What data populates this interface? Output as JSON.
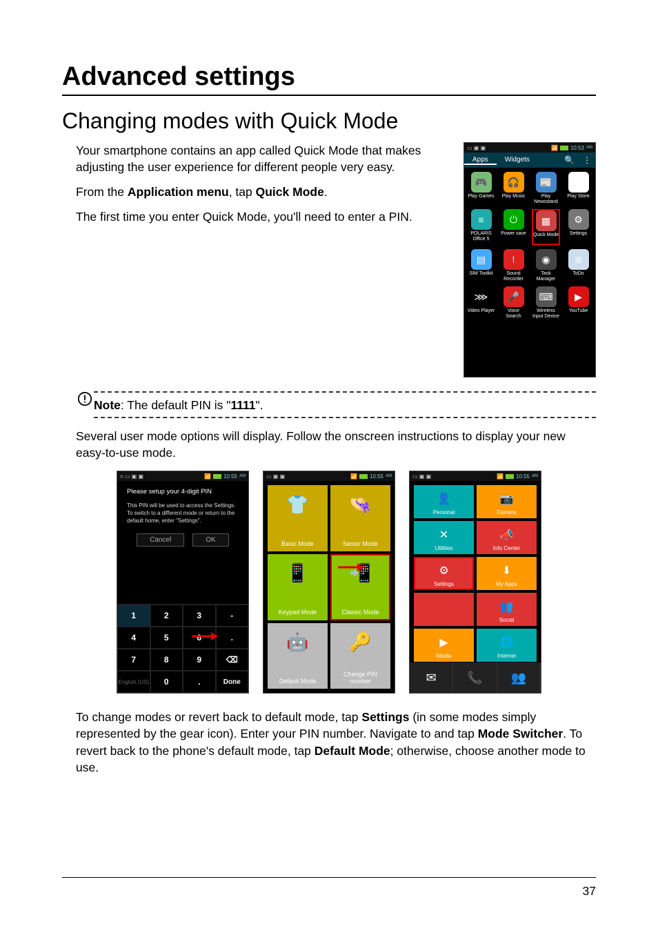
{
  "page_number": "37",
  "headings": {
    "h1": "Advanced settings",
    "h2": "Changing modes with Quick Mode"
  },
  "paragraphs": {
    "p1": "Your smartphone contains an app called Quick Mode that makes adjusting the user experience for different people very easy.",
    "p2_pre": "From the ",
    "p2_b1": "Application menu",
    "p2_mid": ", tap ",
    "p2_b2": "Quick Mode",
    "p2_post": ".",
    "p3": "The first time you enter Quick Mode, you'll need to enter a PIN.",
    "p4": "Several user mode options will display. Follow the onscreen instructions to display your new easy-to-use mode.",
    "p5_a": "To change modes or revert back to default mode, tap ",
    "p5_b1": "Settings",
    "p5_b": " (in some modes simply represented by the gear icon). Enter your PIN number. Navigate to and tap ",
    "p5_b2": "Mode Switcher",
    "p5_c": ". To revert back to the phone's default mode, tap ",
    "p5_b3": "Default Mode",
    "p5_d": "; otherwise, choose another mode to use."
  },
  "note": {
    "label": "Note",
    "text_a": ": The default PIN is \"",
    "pin": "1111",
    "text_b": "\"."
  },
  "phone_main": {
    "status_time": "10:53",
    "status_ampm": "AM",
    "tabs": {
      "apps": "Apps",
      "widgets": "Widgets"
    },
    "apps": [
      {
        "label": "Play Games",
        "bg": "#7b7",
        "glyph": "🎮"
      },
      {
        "label": "Play Music",
        "bg": "#f90",
        "glyph": "🎧"
      },
      {
        "label": "Play\nNewsstand",
        "bg": "#48c",
        "glyph": "📰"
      },
      {
        "label": "Play Store",
        "bg": "#fff",
        "glyph": "▶"
      },
      {
        "label": "POLARIS\nOffice 5",
        "bg": "#2aa",
        "glyph": "≡"
      },
      {
        "label": "Power save",
        "bg": "#0a0",
        "glyph": "⏻"
      },
      {
        "label": "Quick Mode",
        "bg": "#c44",
        "glyph": "▦",
        "highlight": true
      },
      {
        "label": "Settings",
        "bg": "#777",
        "glyph": "⚙"
      },
      {
        "label": "SIM Toolkit",
        "bg": "#4af",
        "glyph": "▤"
      },
      {
        "label": "Sound\nRecorder",
        "bg": "#d22",
        "glyph": "!"
      },
      {
        "label": "Task\nManager",
        "bg": "#444",
        "glyph": "◉"
      },
      {
        "label": "ToDo",
        "bg": "#cde",
        "glyph": "≣"
      },
      {
        "label": "Video Player",
        "bg": "#000",
        "glyph": "⋙"
      },
      {
        "label": "Voice\nSearch",
        "bg": "#d22",
        "glyph": "🎤"
      },
      {
        "label": "Wireless\nInput Device",
        "bg": "#555",
        "glyph": "⌨"
      },
      {
        "label": "YouTube",
        "bg": "#d11",
        "glyph": "▶"
      }
    ]
  },
  "phone_pin": {
    "status_time": "10:55",
    "status_ampm": "AM",
    "heading": "Please setup your 4-digit PIN",
    "subtext": "This PIN will be used to access the Settings. To switch to a different mode or return to the default home, enter \"Settings\".",
    "cancel": "Cancel",
    "ok": "OK",
    "done": "Done",
    "lang": "English (US)",
    "keys": [
      "1",
      "2",
      "3",
      "-",
      "4",
      "5",
      "6",
      ".",
      "7",
      "8",
      "9",
      "⌫"
    ]
  },
  "phone_modes": {
    "status_time": "10:55",
    "status_ampm": "AM",
    "modes": [
      {
        "label": "Basic Mode",
        "cls": "mc-ylw"
      },
      {
        "label": "Senior Mode",
        "cls": "mc-ylw"
      },
      {
        "label": "Keypad Mode",
        "cls": "mc-grn"
      },
      {
        "label": "Classic Mode",
        "cls": "mc-grn",
        "highlight": true
      },
      {
        "label": "Default Mode",
        "cls": "mc-gry"
      },
      {
        "label": "Change PIN\nnumber",
        "cls": "mc-gry"
      }
    ]
  },
  "phone_easy": {
    "status_time": "10:55",
    "status_ampm": "AM",
    "tiles": [
      {
        "label": "Personal",
        "bg": "#0aa"
      },
      {
        "label": "Camera",
        "bg": "#f90"
      },
      {
        "label": "Utilities",
        "bg": "#0aa"
      },
      {
        "label": "Info Center",
        "bg": "#d33"
      },
      {
        "label": "Settings",
        "bg": "#d33",
        "highlight": true
      },
      {
        "label": "My Apps",
        "bg": "#f90"
      },
      {
        "label": "",
        "bg": "#d33"
      },
      {
        "label": "Social",
        "bg": "#d33"
      },
      {
        "label": "Media",
        "bg": "#f90"
      },
      {
        "label": "Internet",
        "bg": "#0aa"
      }
    ]
  }
}
